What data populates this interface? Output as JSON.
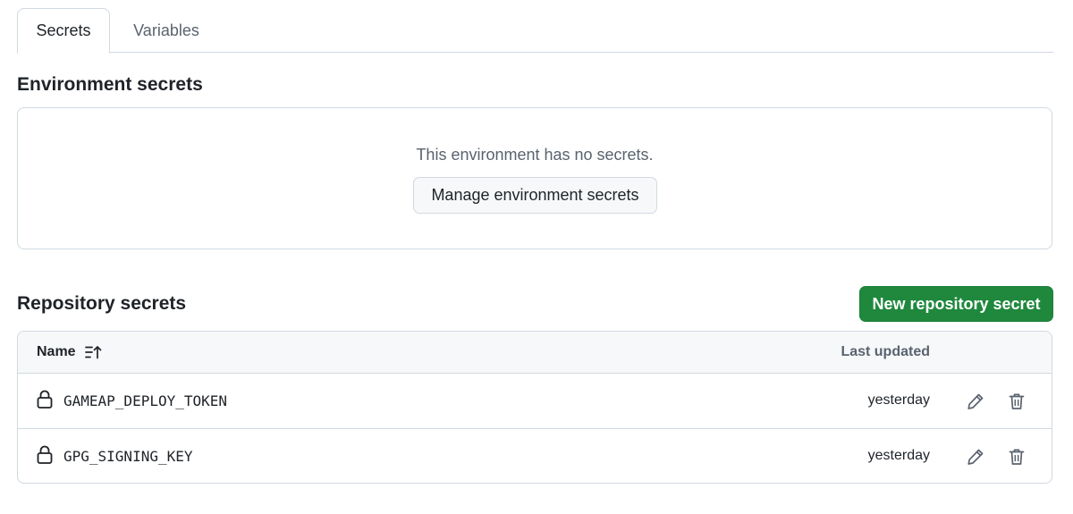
{
  "tabs": [
    {
      "label": "Secrets",
      "active": true
    },
    {
      "label": "Variables",
      "active": false
    }
  ],
  "environment": {
    "heading": "Environment secrets",
    "empty_message": "This environment has no secrets.",
    "manage_button": "Manage environment secrets"
  },
  "repository": {
    "heading": "Repository secrets",
    "new_button": "New repository secret",
    "table": {
      "columns": {
        "name": "Name",
        "last_updated": "Last updated"
      },
      "rows": [
        {
          "name": "GAMEAP_DEPLOY_TOKEN",
          "updated": "yesterday"
        },
        {
          "name": "GPG_SIGNING_KEY",
          "updated": "yesterday"
        }
      ]
    }
  },
  "colors": {
    "primary_green": "#1f883d",
    "border": "#d1d9e0",
    "muted_text": "#59636e"
  },
  "icons": [
    "sort-ascending-icon",
    "lock-icon",
    "pencil-icon",
    "trash-icon"
  ]
}
